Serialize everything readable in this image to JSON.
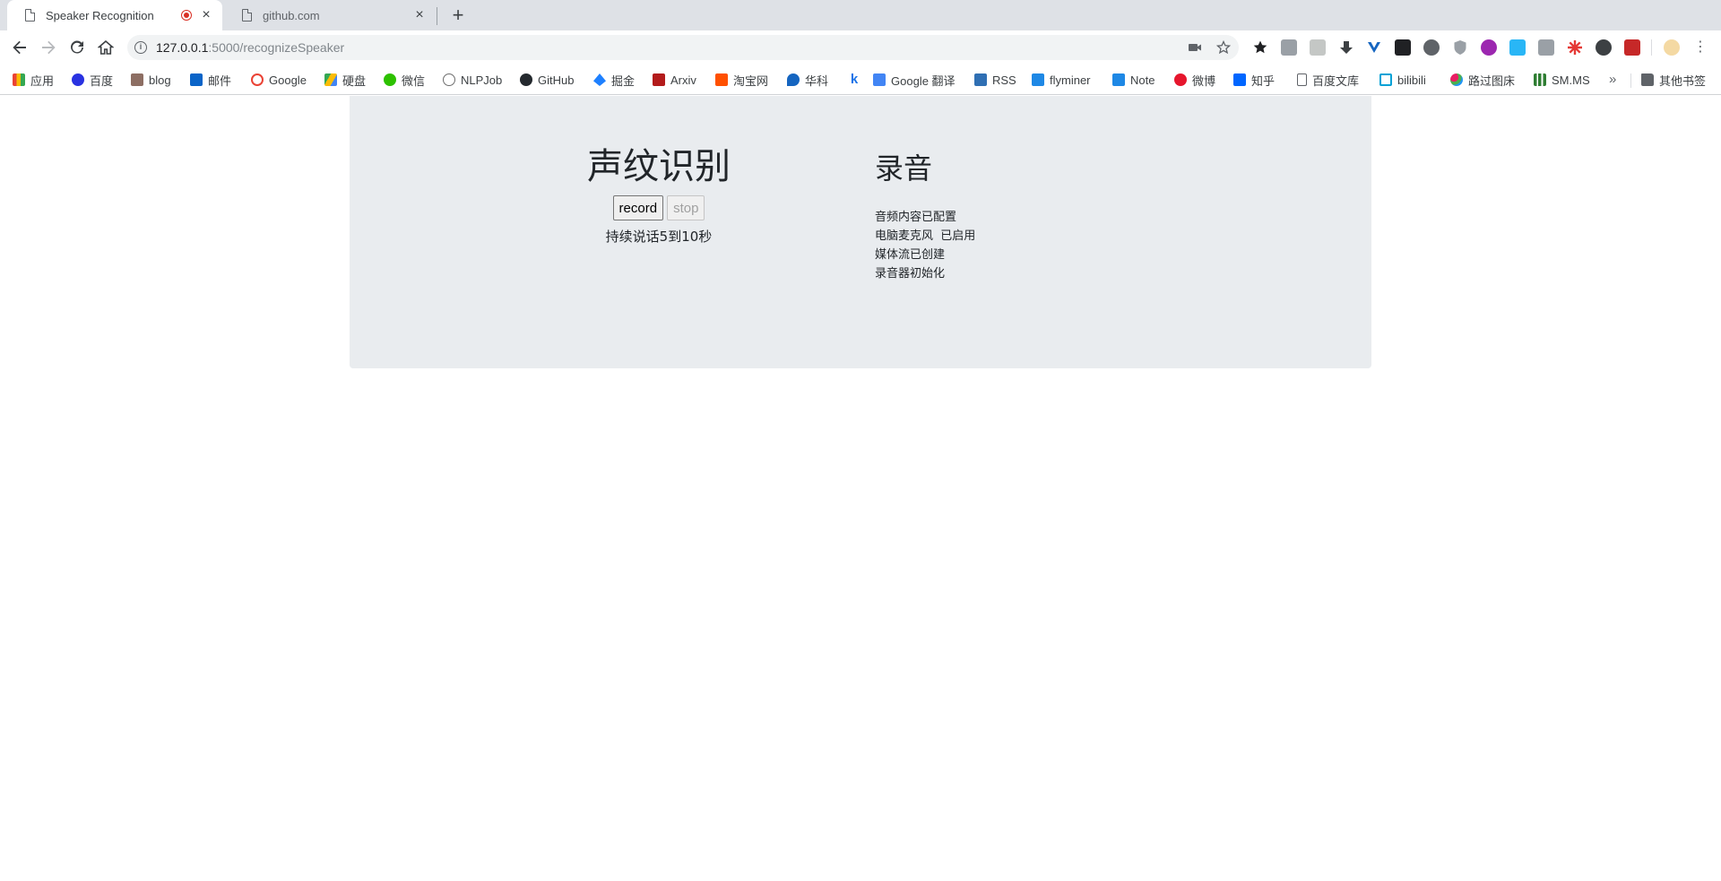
{
  "browser": {
    "tabs": [
      {
        "title": "Speaker Recognition",
        "recording": true,
        "active": true
      },
      {
        "title": "github.com",
        "active": false
      }
    ],
    "new_tab_label": "+",
    "url_host": "127.0.0.1",
    "url_path": ":5000/recognizeSpeaker"
  },
  "bookmarks": [
    {
      "label": "应用",
      "icon": "apps-grid-icon",
      "color": "#4285f4"
    },
    {
      "label": "百度",
      "icon": "baidu-icon",
      "color": "#2932e1"
    },
    {
      "label": "blog",
      "icon": "blog-icon",
      "color": "#8d6e63"
    },
    {
      "label": "邮件",
      "icon": "outlook-icon",
      "color": "#0a64c8"
    },
    {
      "label": "Google",
      "icon": "google-icon",
      "color": "#ea4335"
    },
    {
      "label": "硬盘",
      "icon": "drive-icon",
      "color": "#34a853"
    },
    {
      "label": "微信",
      "icon": "wechat-icon",
      "color": "#2dc100"
    },
    {
      "label": "NLPJob",
      "icon": "nlpjob-icon",
      "color": "#6d6d6d"
    },
    {
      "label": "GitHub",
      "icon": "github-icon",
      "color": "#24292e"
    },
    {
      "label": "掘金",
      "icon": "juejin-icon",
      "color": "#1e80ff"
    },
    {
      "label": "Arxiv",
      "icon": "arxiv-icon",
      "color": "#b31b1b"
    },
    {
      "label": "淘宝网",
      "icon": "taobao-icon",
      "color": "#ff5000"
    },
    {
      "label": "华科",
      "icon": "hust-icon",
      "color": "#1565c0"
    },
    {
      "label": "",
      "icon": "k-icon",
      "color": "#1a73e8"
    },
    {
      "label": "Google 翻译",
      "icon": "translate-icon",
      "color": "#4285f4"
    },
    {
      "label": "RSS",
      "icon": "rss-icon",
      "color": "#2f6fb3"
    },
    {
      "label": "flyminer",
      "icon": "dsm-icon",
      "color": "#1e88e5"
    },
    {
      "label": "Note",
      "icon": "dsm-note-icon",
      "color": "#1e88e5"
    },
    {
      "label": "微博",
      "icon": "weibo-icon",
      "color": "#e6162d"
    },
    {
      "label": "知乎",
      "icon": "zhihu-icon",
      "color": "#0066ff"
    },
    {
      "label": "百度文库",
      "icon": "page-icon",
      "color": "#ffffff"
    },
    {
      "label": "bilibili",
      "icon": "bilibili-icon",
      "color": "#00a1d6"
    },
    {
      "label": "路过图床",
      "icon": "imgbed-icon",
      "color": "#e91e63"
    },
    {
      "label": "SM.MS",
      "icon": "smms-icon",
      "color": "#2e7d32"
    }
  ],
  "bookmarks_overflow": "»",
  "other_bookmarks": "其他书签",
  "page": {
    "title": "声纹识别",
    "record_button": "record",
    "stop_button": "stop",
    "hint": "持续说话5到10秒",
    "log_title": "录音",
    "log_lines": [
      "音频内容已配置",
      "电脑麦克风  已启用",
      "媒体流已创建",
      "录音器初始化"
    ]
  }
}
